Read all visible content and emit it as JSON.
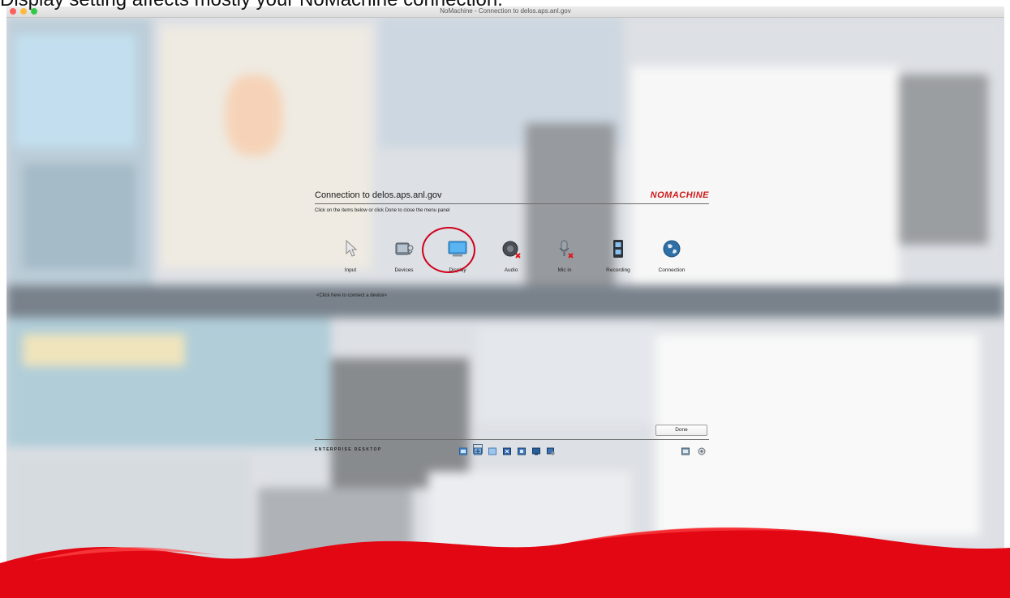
{
  "caption": "Display setting affects mostly your NoMachine connection.",
  "window": {
    "title": "NoMachine - Connection to delos.aps.anl.gov"
  },
  "panel": {
    "title": "Connection to delos.aps.anl.gov",
    "brand": "NOMACHINE",
    "subtitle": "Click on the items below or click Done to close the menu panel",
    "items": [
      {
        "label": "Input",
        "icon": "pointer-icon"
      },
      {
        "label": "Devices",
        "icon": "devices-icon"
      },
      {
        "label": "Display",
        "icon": "monitor-icon",
        "highlighted": true
      },
      {
        "label": "Audio",
        "icon": "speaker-disabled-icon"
      },
      {
        "label": "Mic in",
        "icon": "microphone-disabled-icon"
      },
      {
        "label": "Recording",
        "icon": "film-icon"
      },
      {
        "label": "Connection",
        "icon": "globe-icon"
      }
    ],
    "connect_link": "<Click here to connect a device>",
    "done_label": "Done",
    "footer_label": "ENTERPRISE DESKTOP"
  },
  "colors": {
    "accent": "#d11a1a",
    "highlight_circle": "#d0001c",
    "wave": "#e30613"
  }
}
